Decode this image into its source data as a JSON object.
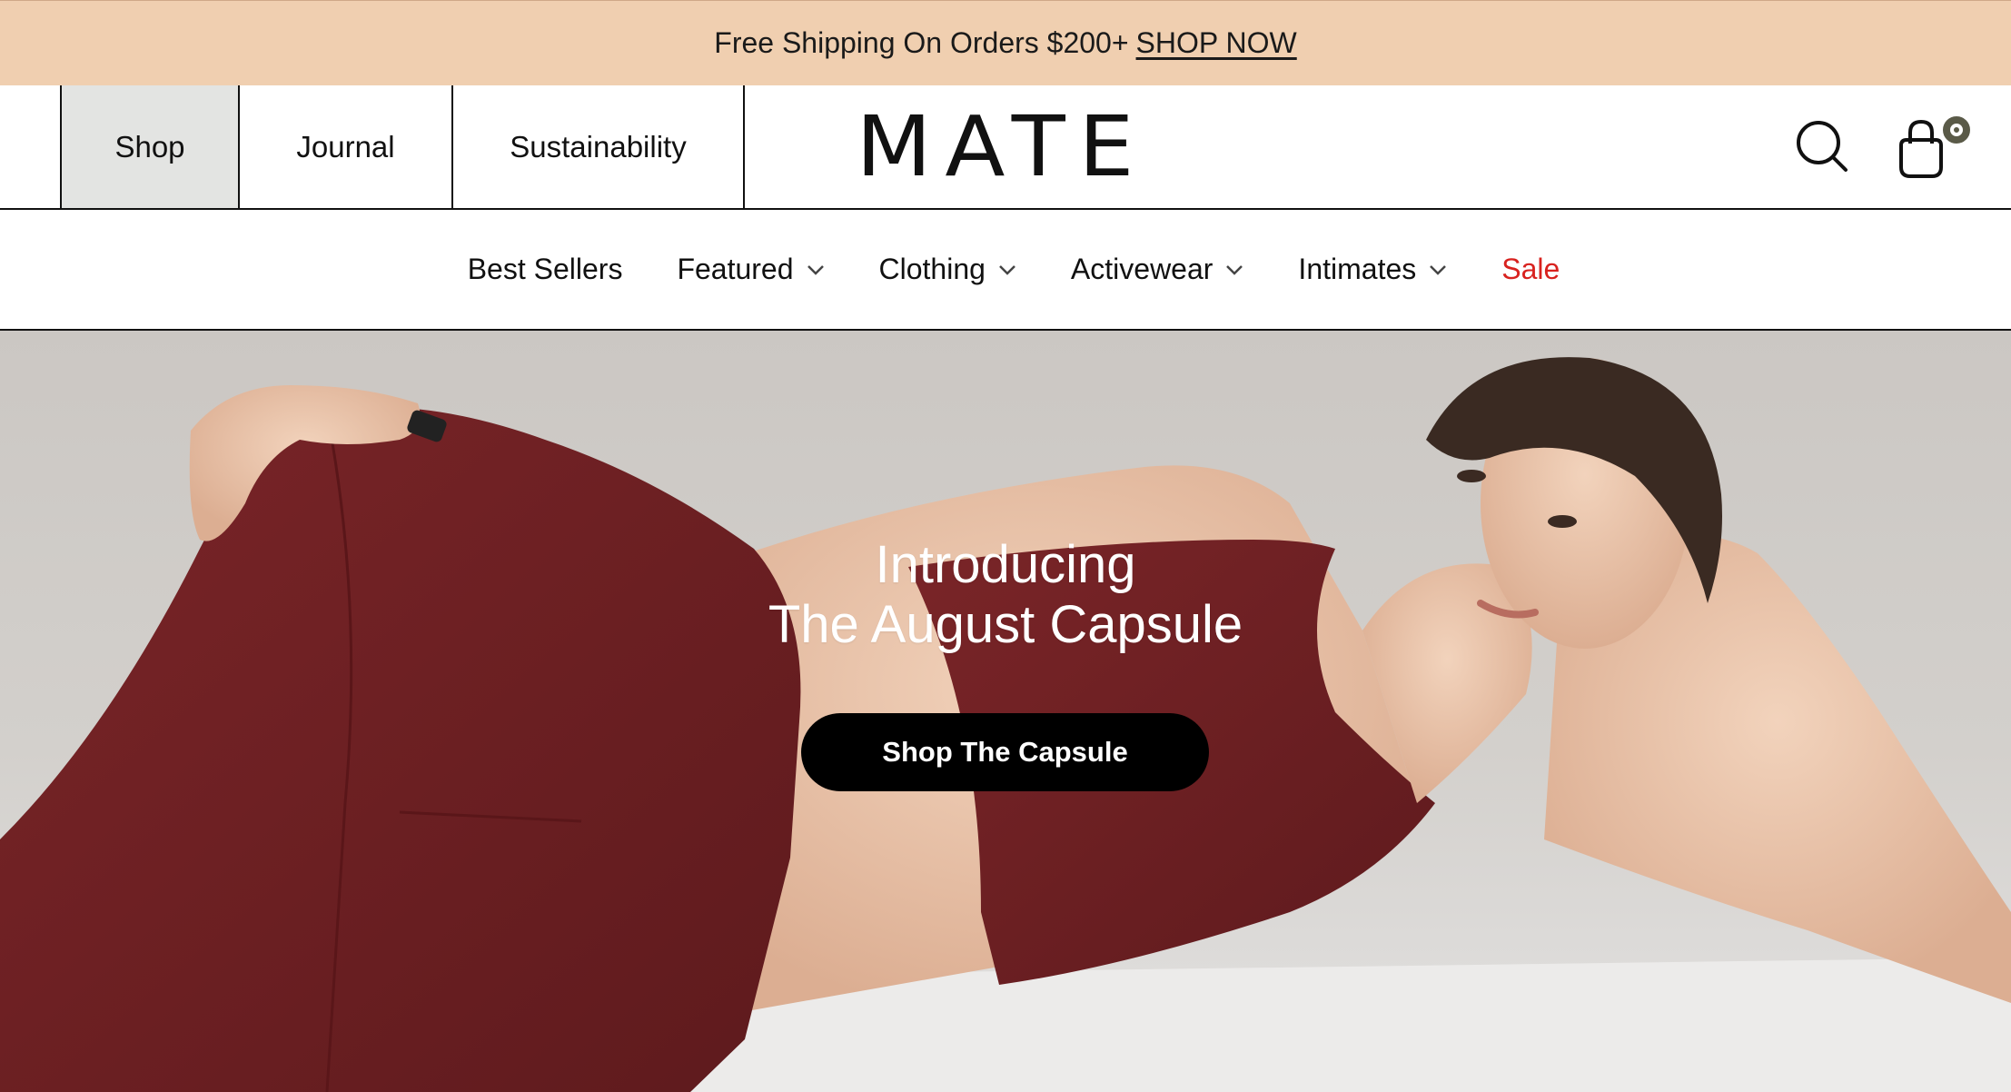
{
  "announcement": {
    "text": "Free Shipping On Orders $200+",
    "cta": "SHOP NOW"
  },
  "topnav": {
    "tabs": [
      {
        "label": "Shop",
        "active": true
      },
      {
        "label": "Journal"
      },
      {
        "label": "Sustainability"
      }
    ],
    "logo": "MATE",
    "search_icon": "search-icon",
    "cart_icon": "shopping-bag-icon",
    "cart_count": "0"
  },
  "catnav": {
    "items": [
      {
        "label": "Best Sellers",
        "dropdown": false
      },
      {
        "label": "Featured",
        "dropdown": true
      },
      {
        "label": "Clothing",
        "dropdown": true
      },
      {
        "label": "Activewear",
        "dropdown": true
      },
      {
        "label": "Intimates",
        "dropdown": true
      },
      {
        "label": "Sale",
        "dropdown": false
      }
    ],
    "sale_color": "#d8221f"
  },
  "hero": {
    "line1": "Introducing",
    "line2": "The August Capsule",
    "button": "Shop The Capsule"
  },
  "colors": {
    "announcement_bg": "#f0cfb0",
    "active_tab_bg": "#e3e4e2",
    "garment": "#6e1f22",
    "button_bg": "#000000"
  }
}
